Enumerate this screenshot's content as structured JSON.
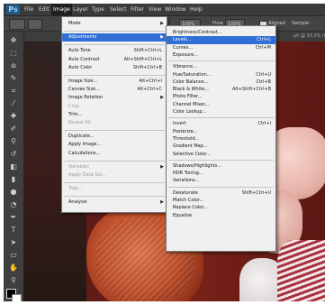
{
  "app": {
    "logo": "Ps"
  },
  "menubar": {
    "items": [
      "File",
      "Edit",
      "Image",
      "Layer",
      "Type",
      "Select",
      "Filter",
      "View",
      "Window",
      "Help"
    ]
  },
  "options_bar": {
    "zoom_label": "100%",
    "flow_label": "Flow:",
    "flow_value": "100%",
    "aligned_label": "Aligned",
    "sample_label": "Sample:"
  },
  "document_tab": {
    "title": "ph @ 33.3% (R"
  },
  "image_menu": {
    "items": [
      {
        "label": "Mode",
        "shortcut": "",
        "submenu": true
      },
      {
        "separator": true
      },
      {
        "label": "Adjustments",
        "shortcut": "",
        "submenu": true,
        "highlighted": true
      },
      {
        "separator": true
      },
      {
        "label": "Auto Tone",
        "shortcut": "Shift+Ctrl+L"
      },
      {
        "label": "Auto Contrast",
        "shortcut": "Alt+Shift+Ctrl+L"
      },
      {
        "label": "Auto Color",
        "shortcut": "Shift+Ctrl+B"
      },
      {
        "separator": true
      },
      {
        "label": "Image Size...",
        "shortcut": "Alt+Ctrl+I"
      },
      {
        "label": "Canvas Size...",
        "shortcut": "Alt+Ctrl+C"
      },
      {
        "label": "Image Rotation",
        "shortcut": "",
        "submenu": true
      },
      {
        "label": "Crop",
        "shortcut": "",
        "disabled": true
      },
      {
        "label": "Trim...",
        "shortcut": ""
      },
      {
        "label": "Reveal All",
        "shortcut": "",
        "disabled": true
      },
      {
        "separator": true
      },
      {
        "label": "Duplicate...",
        "shortcut": ""
      },
      {
        "label": "Apply Image...",
        "shortcut": ""
      },
      {
        "label": "Calculations...",
        "shortcut": ""
      },
      {
        "separator": true
      },
      {
        "label": "Variables",
        "shortcut": "",
        "submenu": true,
        "disabled": true
      },
      {
        "label": "Apply Data Set...",
        "shortcut": "",
        "disabled": true
      },
      {
        "separator": true
      },
      {
        "label": "Trap...",
        "shortcut": "",
        "disabled": true
      },
      {
        "separator": true
      },
      {
        "label": "Analysis",
        "shortcut": "",
        "submenu": true
      }
    ]
  },
  "adjustments_menu": {
    "items": [
      {
        "label": "Brightness/Contrast...",
        "shortcut": ""
      },
      {
        "label": "Levels...",
        "shortcut": "Ctrl+L",
        "highlighted": true
      },
      {
        "label": "Curves...",
        "shortcut": "Ctrl+M"
      },
      {
        "label": "Exposure...",
        "shortcut": ""
      },
      {
        "separator": true
      },
      {
        "label": "Vibrance...",
        "shortcut": ""
      },
      {
        "label": "Hue/Saturation...",
        "shortcut": "Ctrl+U"
      },
      {
        "label": "Color Balance...",
        "shortcut": "Ctrl+B"
      },
      {
        "label": "Black & White...",
        "shortcut": "Alt+Shift+Ctrl+B"
      },
      {
        "label": "Photo Filter...",
        "shortcut": ""
      },
      {
        "label": "Channel Mixer...",
        "shortcut": ""
      },
      {
        "label": "Color Lookup...",
        "shortcut": ""
      },
      {
        "separator": true
      },
      {
        "label": "Invert",
        "shortcut": "Ctrl+I"
      },
      {
        "label": "Posterize...",
        "shortcut": ""
      },
      {
        "label": "Threshold...",
        "shortcut": ""
      },
      {
        "label": "Gradient Map...",
        "shortcut": ""
      },
      {
        "label": "Selective Color...",
        "shortcut": ""
      },
      {
        "separator": true
      },
      {
        "label": "Shadows/Highlights...",
        "shortcut": ""
      },
      {
        "label": "HDR Toning...",
        "shortcut": ""
      },
      {
        "label": "Variations...",
        "shortcut": ""
      },
      {
        "separator": true
      },
      {
        "label": "Desaturate",
        "shortcut": "Shift+Ctrl+U"
      },
      {
        "label": "Match Color...",
        "shortcut": ""
      },
      {
        "label": "Replace Color...",
        "shortcut": ""
      },
      {
        "label": "Equalize",
        "shortcut": ""
      }
    ]
  },
  "colors": {
    "highlight": "#2f6fd6",
    "menu_bg": "#f0f0f0",
    "chrome": "#535353"
  }
}
